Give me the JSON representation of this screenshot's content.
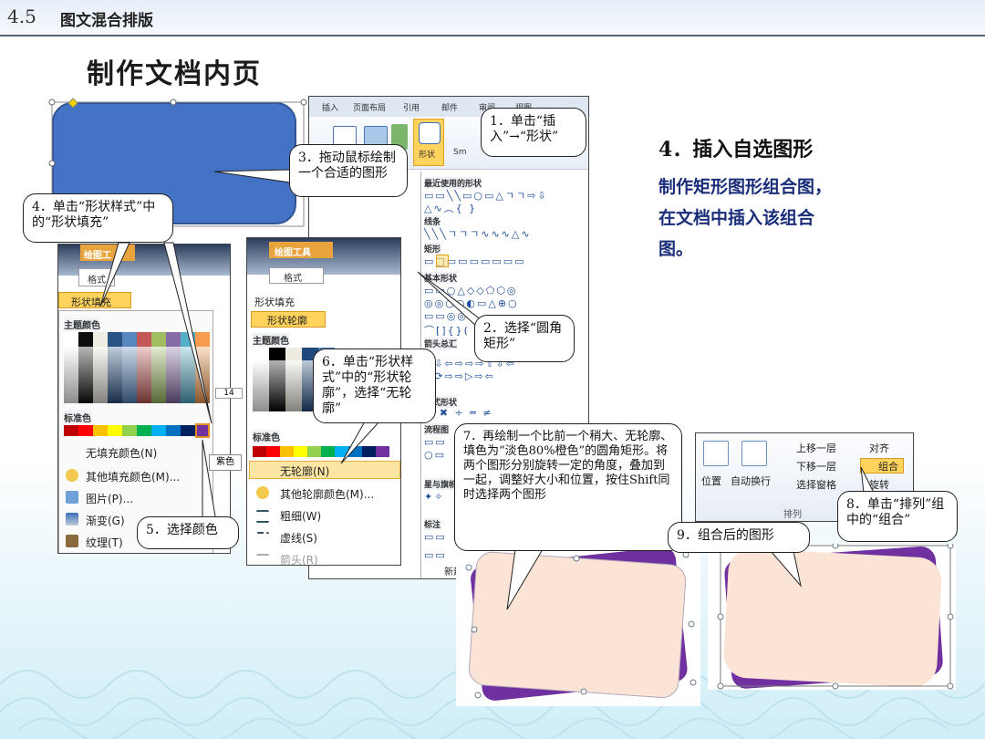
{
  "header": {
    "section_number": "4.5",
    "section_title": "图文混合排版"
  },
  "page_title": "制作文档内页",
  "description": {
    "heading": "4．插入自选图形",
    "lines": [
      "制作矩形图形组合图，",
      "在文档中插入该组合",
      "图。"
    ]
  },
  "ribbon": {
    "tabs": [
      "插入",
      "页面布局",
      "引用",
      "邮件",
      "审阅",
      "视图"
    ],
    "shape_button": "形状",
    "smart_label": "Sm"
  },
  "shapes_gallery": {
    "sections": [
      "最近使用的形状",
      "线条",
      "矩形",
      "基本形状",
      "箭头总汇",
      "公式形状",
      "流程图",
      "星与旗帜",
      "标注"
    ],
    "new_canvas": "新建"
  },
  "fill_menu": {
    "drawing_tools": "绘图工",
    "format_tab": "格式",
    "fill_button": "形状填充",
    "theme_colors": "主题颜色",
    "standard_colors": "标准色",
    "items": [
      "无填充颜色(N)",
      "其他填充颜色(M)...",
      "图片(P)...",
      "渐变(G)",
      "纹理(T)"
    ],
    "side_text": "紫色"
  },
  "outline_menu": {
    "drawing_tools": "绘图工具",
    "format_tab": "格式",
    "fill_button": "形状填充",
    "outline_button": "形状轮廓",
    "theme_colors": "主题颜色",
    "standard_colors": "标准色",
    "items": [
      "无轮廓(N)",
      "其他轮廓颜色(M)...",
      "粗细(W)",
      "虚线(S)",
      "箭头(R)"
    ]
  },
  "arrange_panel": {
    "position": "位置",
    "wrap": "自动换行",
    "bring_forward": "上移一层",
    "send_backward": "下移一层",
    "selection_pane": "选择窗格",
    "align": "对齐",
    "group": "组合",
    "rotate": "旋转",
    "group_label": "排列"
  },
  "callouts": {
    "c1": "1．单击“插入”→“形状”",
    "c2": "2．选择“圆角矩形”",
    "c3": "3．拖动鼠标绘制一个合适的图形",
    "c4": "4．单击“形状样式”中的“形状填充”",
    "c5": "5．选择颜色",
    "c6": "6．单击“形状样式”中的“形状轮廓”，选择“无轮廓”",
    "c7": "7．再绘制一个比前一个稍大、无轮廓、填色为“淡色80%橙色”的圆角矩形。将两个图形分别旋转一定的角度，叠加到一起，调整好大小和位置，按住Shift同时选择两个图形",
    "c8": "8．单击“排列”组中的“组合”",
    "c9": "9．组合后的图形"
  },
  "colors": {
    "blue_shape": "#4472c4",
    "peach_fill": "#fbe4d5",
    "purple_band": "#7030a0",
    "heading_blue": "#1a2e7a"
  },
  "ruler_number": "14"
}
